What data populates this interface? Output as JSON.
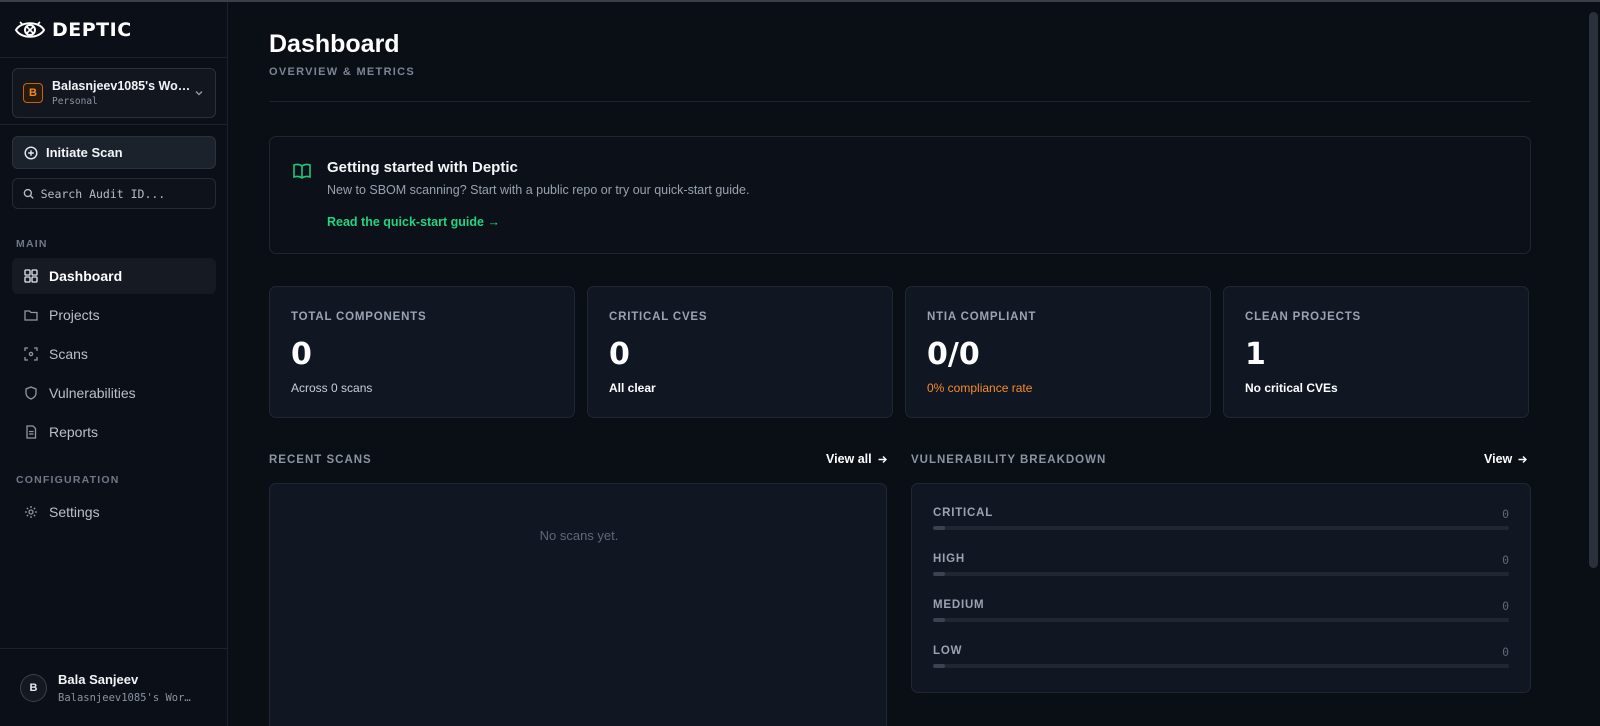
{
  "app": {
    "name": "DEPTIC"
  },
  "workspace": {
    "initial": "B",
    "name": "Balasnjeev1085's Wor…",
    "type": "Personal"
  },
  "actions": {
    "initiate_label": "Initiate Scan"
  },
  "search": {
    "placeholder": "Search Audit ID..."
  },
  "sections": {
    "main": "MAIN",
    "config": "CONFIGURATION"
  },
  "nav": [
    {
      "label": "Dashboard",
      "icon": "dashboard-icon",
      "active": true
    },
    {
      "label": "Projects",
      "icon": "folder-icon",
      "active": false
    },
    {
      "label": "Scans",
      "icon": "scan-icon",
      "active": false
    },
    {
      "label": "Vulnerabilities",
      "icon": "shield-icon",
      "active": false
    },
    {
      "label": "Reports",
      "icon": "document-icon",
      "active": false
    }
  ],
  "config_nav": [
    {
      "label": "Settings",
      "icon": "gear-icon",
      "active": false
    }
  ],
  "user": {
    "initial": "B",
    "name": "Bala Sanjeev",
    "workspace": "Balasnjeev1085's Wor…"
  },
  "header": {
    "title": "Dashboard",
    "subtitle": "OVERVIEW & METRICS"
  },
  "getting_started": {
    "title": "Getting started with Deptic",
    "description": "New to SBOM scanning? Start with a public repo or try our quick-start guide.",
    "link": "Read the quick-start guide →"
  },
  "stats": [
    {
      "label": "TOTAL COMPONENTS",
      "value": "0",
      "sub": "Across 0 scans",
      "sub_color": "muted"
    },
    {
      "label": "CRITICAL CVES",
      "value": "0",
      "sub": "All clear",
      "sub_color": "white"
    },
    {
      "label": "NTIA COMPLIANT",
      "value": "0/0",
      "sub": "0% compliance rate",
      "sub_color": "orange"
    },
    {
      "label": "CLEAN PROJECTS",
      "value": "1",
      "sub": "No critical CVEs",
      "sub_color": "white"
    }
  ],
  "recent_scans": {
    "title": "RECENT SCANS",
    "view_all": "View all",
    "empty": "No scans yet."
  },
  "vulnerability_breakdown": {
    "title": "VULNERABILITY BREAKDOWN",
    "view": "View",
    "rows": [
      {
        "label": "CRITICAL",
        "count": "0",
        "fraction": 0.02
      },
      {
        "label": "HIGH",
        "count": "0",
        "fraction": 0.02
      },
      {
        "label": "MEDIUM",
        "count": "0",
        "fraction": 0.02
      },
      {
        "label": "LOW",
        "count": "0",
        "fraction": 0.02
      }
    ]
  },
  "colors": {
    "accent_green": "#22d47f",
    "accent_orange": "#f48c2b",
    "background": "#0a0e15"
  }
}
